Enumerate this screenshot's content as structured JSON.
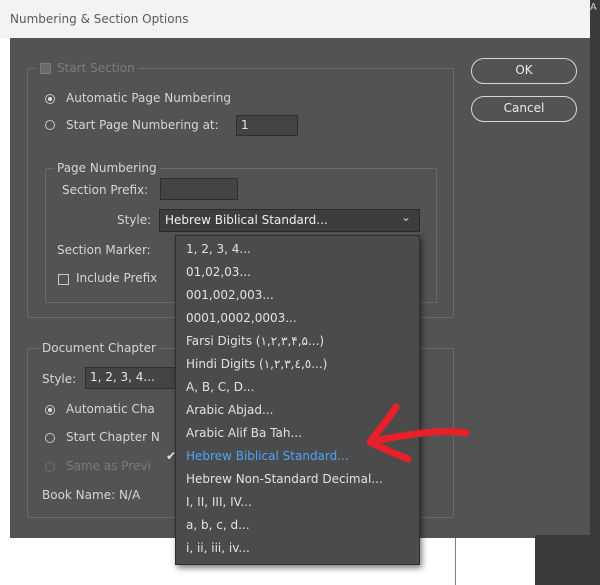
{
  "dialog": {
    "title": "Numbering & Section Options",
    "ok_label": "OK",
    "cancel_label": "Cancel",
    "start_section_label": "Start Section",
    "automatic_page_numbering_label": "Automatic Page Numbering",
    "start_page_numbering_label": "Start Page Numbering at:",
    "start_page_value": "1",
    "page_numbering": {
      "group_label": "Page Numbering",
      "section_prefix_label": "Section Prefix:",
      "section_prefix_value": "",
      "style_label": "Style:",
      "style_value": "Hebrew Biblical Standard...",
      "section_marker_label": "Section Marker:",
      "include_prefix_label": "Include Prefix"
    },
    "document_chapter": {
      "group_label": "Document Chapter",
      "style_label": "Style:",
      "style_value": "1, 2, 3, 4...",
      "automatic_chapter_label": "Automatic Cha",
      "start_chapter_label": "Start Chapter N",
      "same_as_previous_label": "Same as Previ",
      "book_name_label": "Book Name: N/A"
    }
  },
  "style_dropdown": {
    "selected_index": 9,
    "options": [
      "1, 2, 3, 4...",
      "01,02,03...",
      "001,002,003...",
      "0001,0002,0003...",
      "Farsi Digits (١,٢,٣,۴,۵...)",
      "Hindi Digits (١,٢,٣,٤,٥...)",
      "A, B, C, D...",
      "Arabic Abjad...",
      "Arabic Alif Ba Tah...",
      "Hebrew Biblical Standard...",
      "Hebrew Non-Standard Decimal...",
      "I, II, III, IV...",
      "a, b, c, d...",
      "i, ii, iii, iv..."
    ]
  },
  "colors": {
    "dialog_bg": "#535353",
    "selected_item": "#4da3ff",
    "annotation_arrow": "#e8202a"
  },
  "icons": {
    "checkmark": "✔",
    "chevron": "⌄",
    "edge_letter": "A"
  }
}
